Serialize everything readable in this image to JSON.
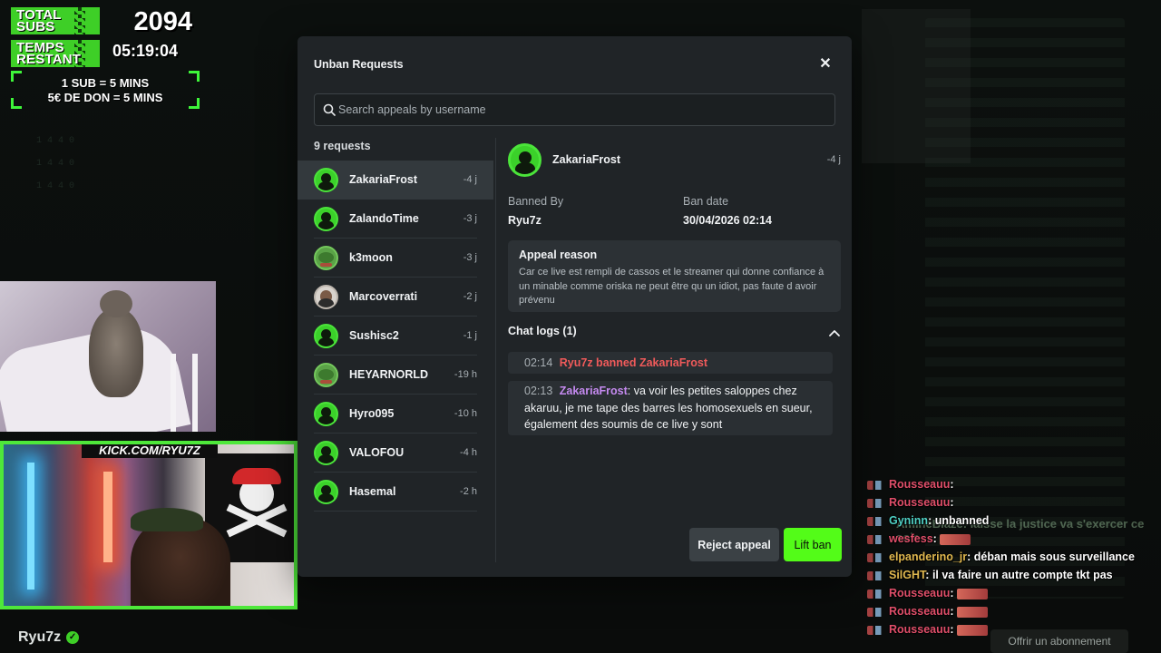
{
  "overlay": {
    "total_subs_label": "TOTAL SUBS",
    "total_subs_value": "2094",
    "time_left_label": "TEMPS RESTANT",
    "time_left_value": "05:19:04",
    "rule_1": "1 SUB = 5 MINS",
    "rule_2": "5€ DE DON = 5 MINS",
    "kick_url": "KICK.COM/RYU7Z",
    "streamer_name": "Ryu7z",
    "subscribe_label": "Offrir un abonnement"
  },
  "chat_overlay": {
    "messages": [
      {
        "user": "Rousseauu",
        "user_color": "#e04f6a",
        "text": "",
        "emote": false
      },
      {
        "user": "Rousseauu",
        "user_color": "#e04f6a",
        "text": "",
        "emote": false
      },
      {
        "user": "Gyninn",
        "user_color": "#4fd1c5",
        "text": "unbanned",
        "emote": false
      },
      {
        "user": "wesfess",
        "user_color": "#e04f6a",
        "text": "",
        "emote": true
      },
      {
        "user": "elpanderino_jr",
        "user_color": "#e0b84f",
        "text": "déban mais sous surveillance",
        "emote": false
      },
      {
        "user": "SilGHT",
        "user_color": "#e0b84f",
        "text": "il va faire un autre compte tkt pas",
        "emote": false
      },
      {
        "user": "Rousseauu",
        "user_color": "#e04f6a",
        "text": "",
        "emote": true
      },
      {
        "user": "Rousseauu",
        "user_color": "#e04f6a",
        "text": "",
        "emote": true
      },
      {
        "user": "Rousseauu",
        "user_color": "#e04f6a",
        "text": "",
        "emote": true
      }
    ],
    "ghost_text": "AmineBlaze: laisse la justice va s'exercer ce soir"
  },
  "modal": {
    "title": "Unban Requests",
    "search_placeholder": "Search appeals by username",
    "request_count": "9 requests",
    "requests": [
      {
        "name": "ZakariaFrost",
        "time": "-4 j",
        "avatar": "green"
      },
      {
        "name": "ZalandoTime",
        "time": "-3 j",
        "avatar": "green"
      },
      {
        "name": "k3moon",
        "time": "-3 j",
        "avatar": "pepe"
      },
      {
        "name": "Marcoverrati",
        "time": "-2 j",
        "avatar": "photo"
      },
      {
        "name": "Sushisc2",
        "time": "-1 j",
        "avatar": "green"
      },
      {
        "name": "HEYARNORLD",
        "time": "-19 h",
        "avatar": "pepe"
      },
      {
        "name": "Hyro095",
        "time": "-10 h",
        "avatar": "green"
      },
      {
        "name": "VALOFOU",
        "time": "-4 h",
        "avatar": "green"
      },
      {
        "name": "Hasemal",
        "time": "-2 h",
        "avatar": "green"
      }
    ],
    "detail": {
      "name": "ZakariaFrost",
      "time": "-4 j",
      "banned_by_label": "Banned By",
      "banned_by": "Ryu7z",
      "ban_date_label": "Ban date",
      "ban_date": "30/04/2026 02:14",
      "appeal_title": "Appeal reason",
      "appeal_text": "Car ce live est rempli de cassos et le streamer qui donne confiance à un minable comme oriska ne peut être qu un idiot, pas faute d avoir prévenu",
      "chat_logs_title": "Chat logs (1)",
      "log_1_time": "02:14",
      "log_1_text": "Ryu7z banned ZakariaFrost",
      "log_2_time": "02:13",
      "log_2_user": "ZakariaFrost",
      "log_2_text": ": va voir les petites saloppes chez akaruu, je me tape des barres les homosexuels en sueur, également des soumis de ce live y sont"
    },
    "reject_label": "Reject appeal",
    "lift_label": "Lift ban"
  },
  "colors": {
    "accent": "#53fc18",
    "modal_bg": "#202427",
    "danger": "#f05a5a",
    "username": "#c58af0"
  }
}
